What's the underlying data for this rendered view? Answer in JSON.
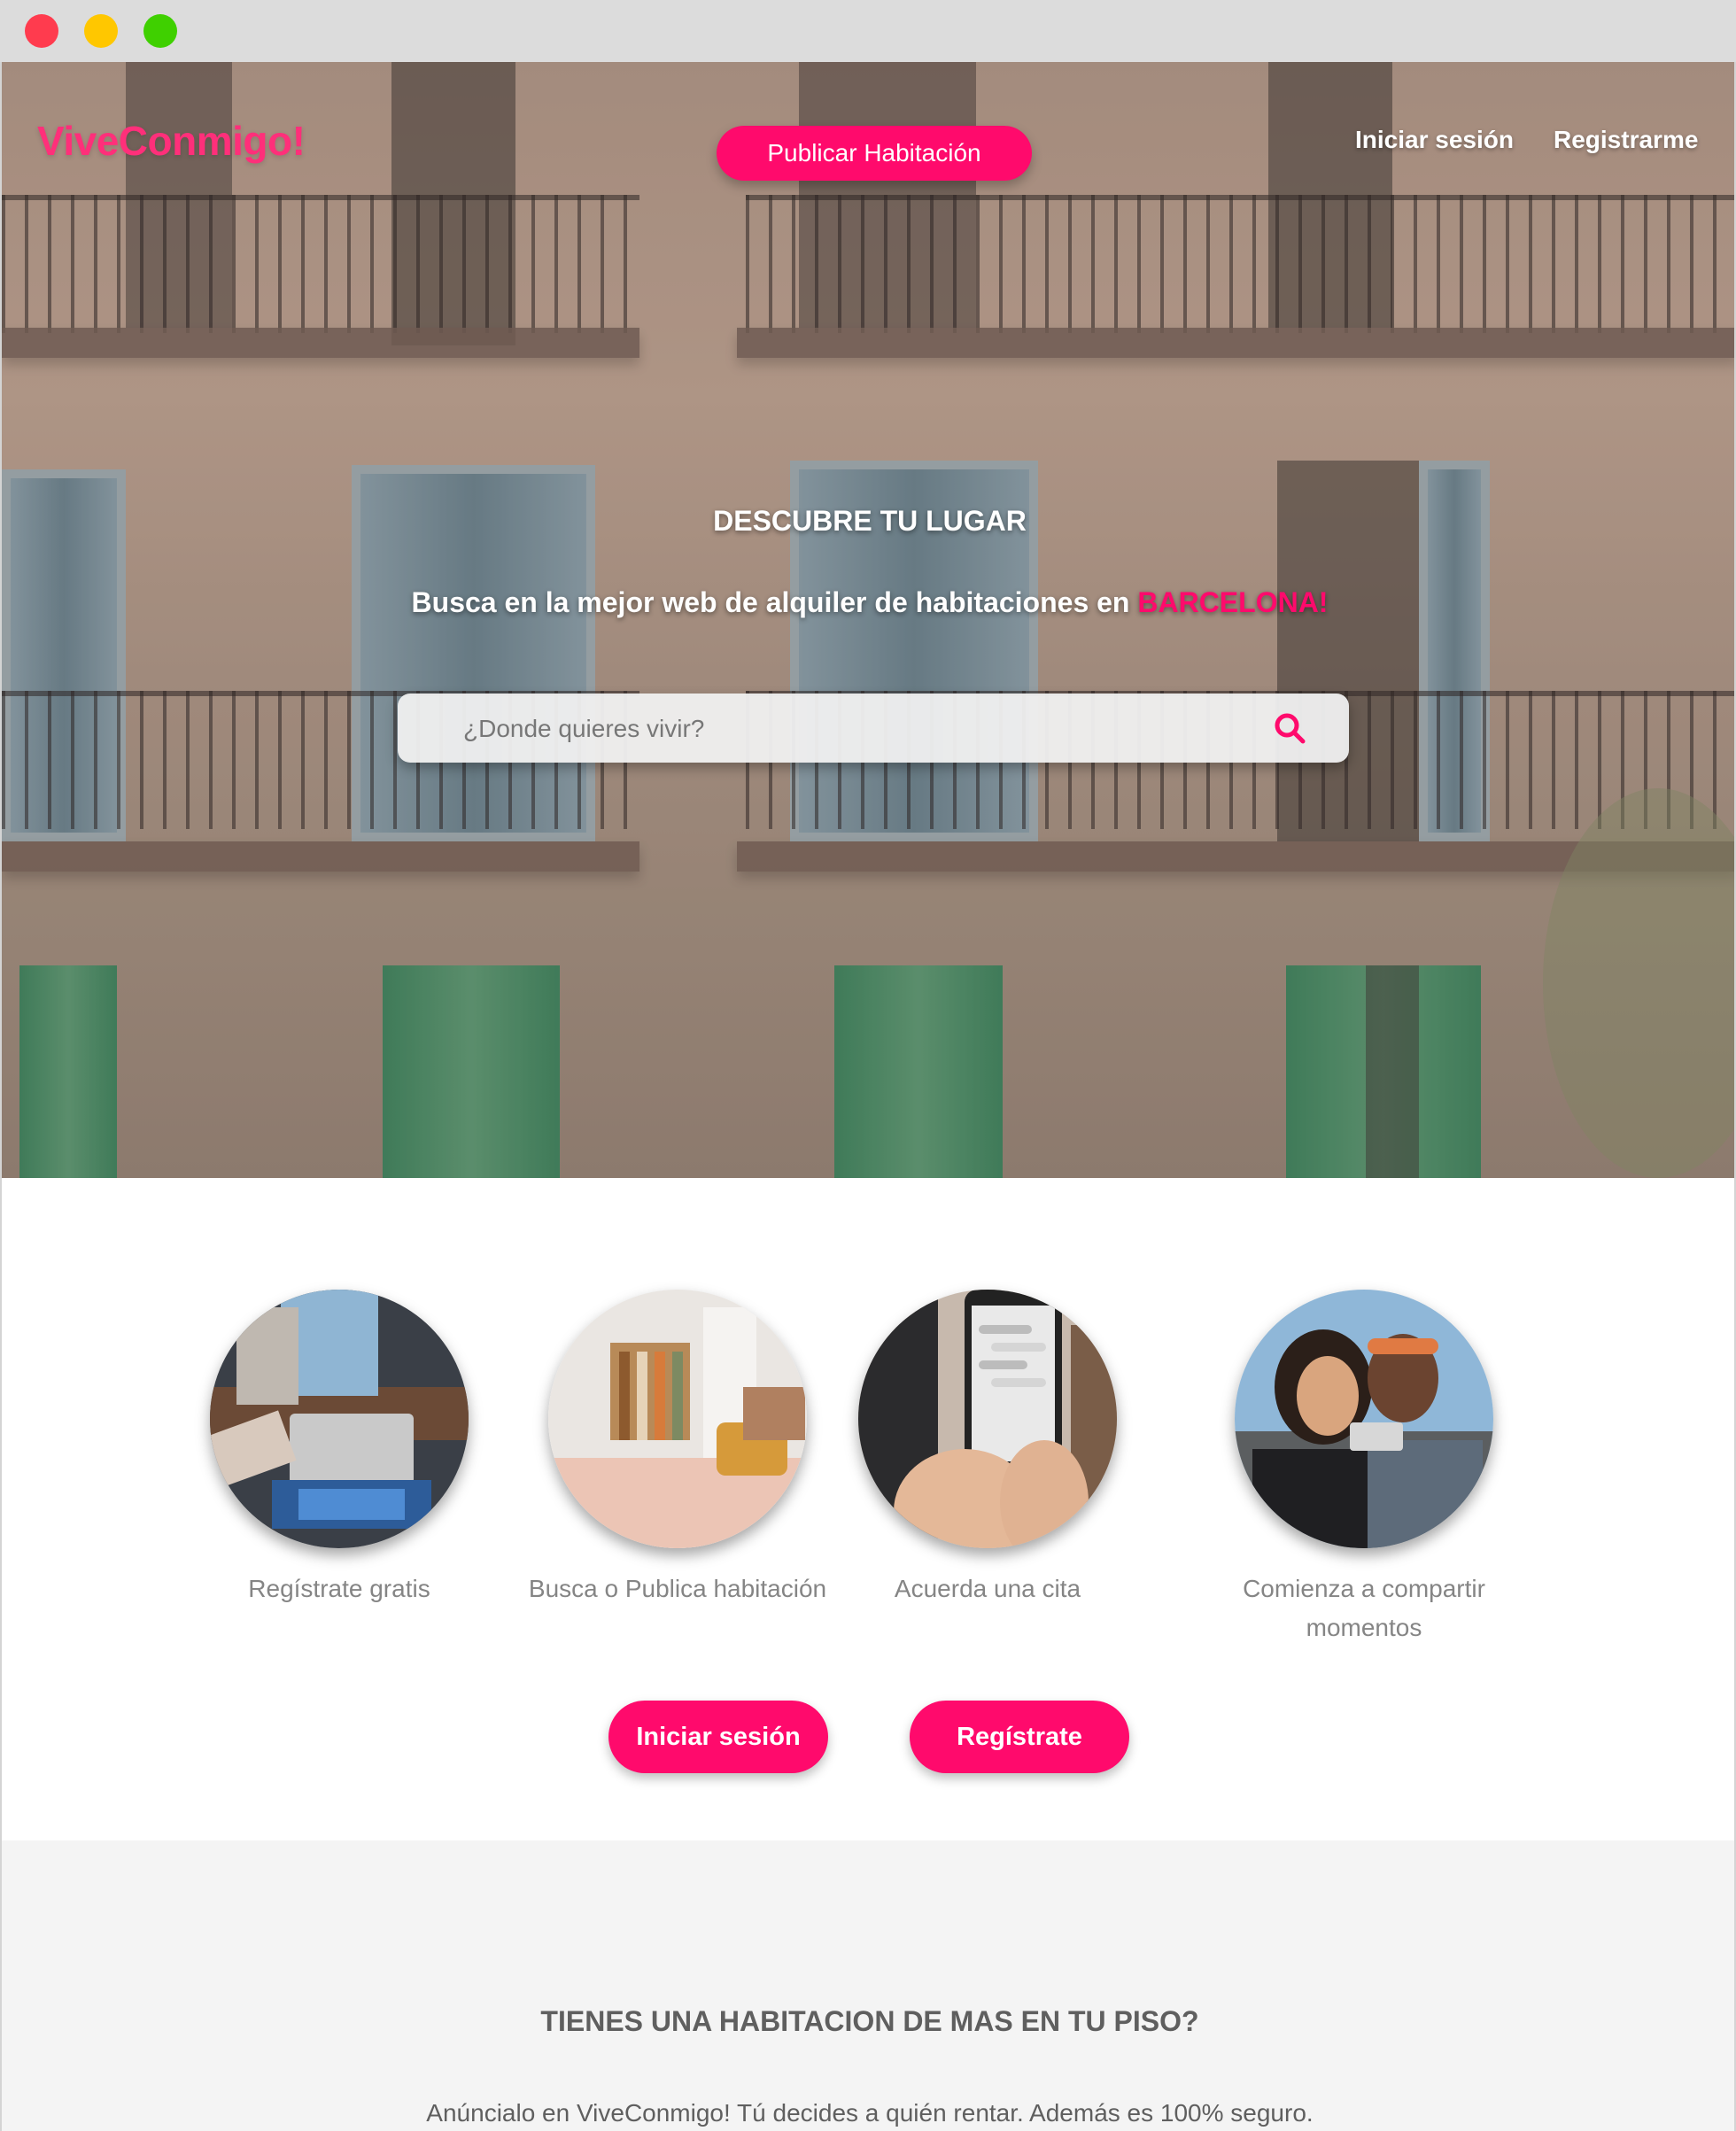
{
  "brand": {
    "name": "ViveConmigo!",
    "accent": "#ff0a6c"
  },
  "header": {
    "publish_label": "Publicar Habitación",
    "login_label": "Iniciar sesión",
    "register_label": "Registrarme"
  },
  "hero": {
    "title": "DESCUBRE TU LUGAR",
    "subtitle_prefix": "Busca en la mejor web de alquiler de habitaciones en ",
    "subtitle_city": "BARCELONA!",
    "search": {
      "placeholder": "¿Donde quieres vivir?",
      "value": "",
      "icon": "search-icon"
    }
  },
  "steps": [
    {
      "label": "Regístrate gratis",
      "image": "laptop-photo"
    },
    {
      "label": "Busca o Publica habitación",
      "image": "bedroom-photo"
    },
    {
      "label": "Acuerda una cita",
      "image": "phone-chat-photo"
    },
    {
      "label": "Comienza a compartir momentos",
      "image": "friends-selfie-photo"
    }
  ],
  "actions": {
    "login_label": "Iniciar sesión",
    "register_label": "Regístrate"
  },
  "cta": {
    "title": "TIENES UNA HABITACION DE MAS EN TU PISO?",
    "text": "Anúncialo en ViveConmigo! Tú decides a quién rentar. Además es 100% seguro."
  }
}
